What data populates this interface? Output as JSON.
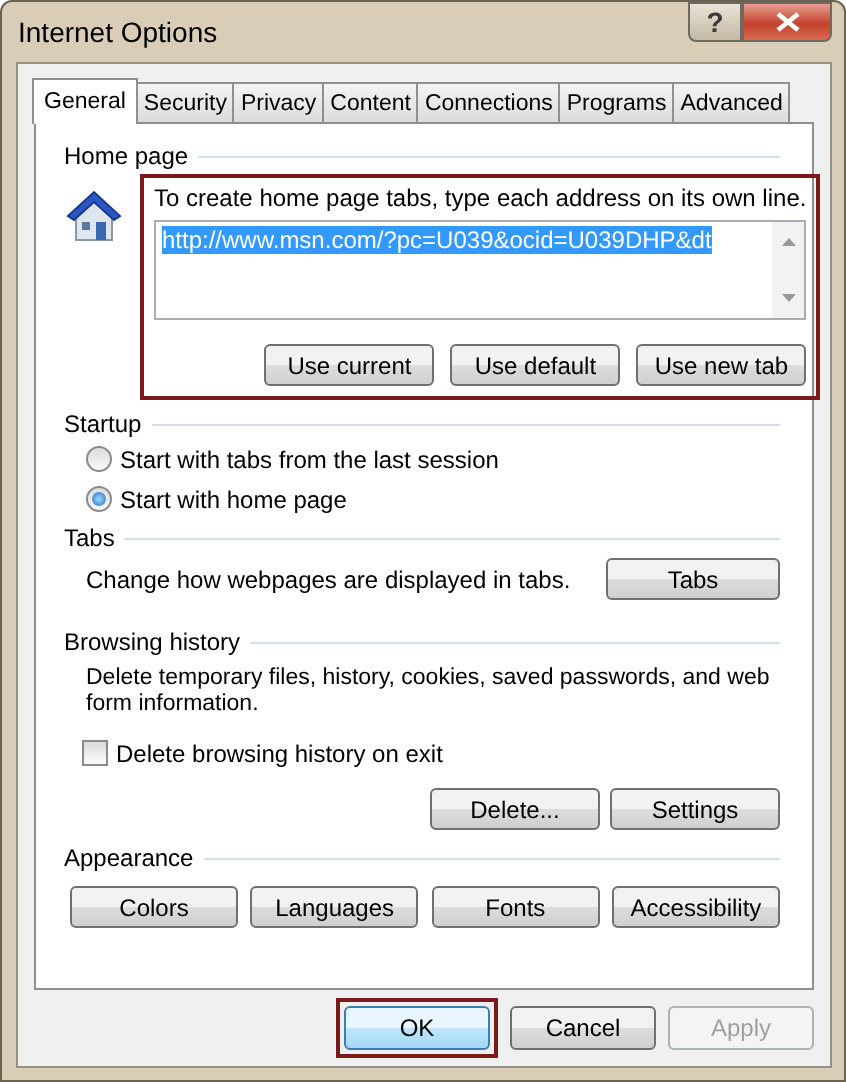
{
  "window": {
    "title": "Internet Options",
    "help_button": "?"
  },
  "tabs": [
    {
      "label": "General",
      "selected": true
    },
    {
      "label": "Security",
      "selected": false
    },
    {
      "label": "Privacy",
      "selected": false
    },
    {
      "label": "Content",
      "selected": false
    },
    {
      "label": "Connections",
      "selected": false
    },
    {
      "label": "Programs",
      "selected": false
    },
    {
      "label": "Advanced",
      "selected": false
    }
  ],
  "home_page": {
    "title": "Home page",
    "highlighted": true,
    "instruction": "To create home page tabs, type each address on its own line.",
    "address": "http://www.msn.com/?pc=U039&ocid=U039DHP&dt",
    "address_selected": true,
    "buttons": [
      "Use current",
      "Use default",
      "Use new tab"
    ]
  },
  "startup": {
    "title": "Startup",
    "options": [
      {
        "label": "Start with tabs from the last session",
        "selected": false
      },
      {
        "label": "Start with home page",
        "selected": true
      }
    ]
  },
  "tabs_section": {
    "title": "Tabs",
    "description": "Change how webpages are displayed in tabs.",
    "button": "Tabs"
  },
  "browsing_history": {
    "title": "Browsing history",
    "description": "Delete temporary files, history, cookies, saved passwords, and web form information.",
    "checkbox": {
      "label": "Delete browsing history on exit",
      "checked": false
    },
    "buttons": [
      "Delete...",
      "Settings"
    ]
  },
  "appearance": {
    "title": "Appearance",
    "buttons": [
      "Colors",
      "Languages",
      "Fonts",
      "Accessibility"
    ]
  },
  "footer_buttons": [
    {
      "label": "OK",
      "default": true,
      "highlighted": true,
      "disabled": false
    },
    {
      "label": "Cancel",
      "default": false,
      "highlighted": false,
      "disabled": false
    },
    {
      "label": "Apply",
      "default": false,
      "highlighted": false,
      "disabled": true
    }
  ]
}
